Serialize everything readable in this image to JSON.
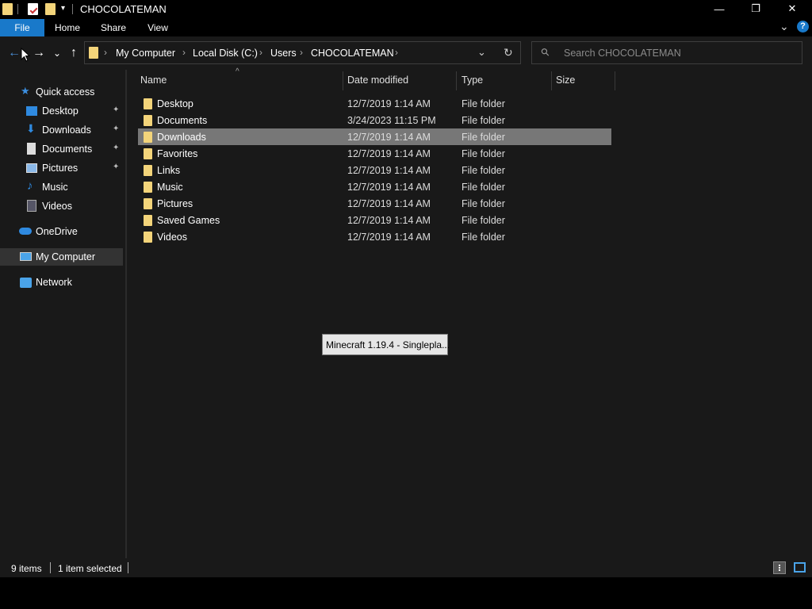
{
  "window": {
    "title": "CHOCOLATEMAN",
    "minimize": "—",
    "restore": "❐",
    "close": "✕"
  },
  "ribbon": {
    "tabs": [
      "File",
      "Home",
      "Share",
      "View"
    ],
    "expand": "⌄",
    "help": "?"
  },
  "nav": {
    "back": "←",
    "forward": "→",
    "recent": "⌄",
    "up": "↑"
  },
  "address": {
    "crumbs": [
      "My Computer",
      "Local Disk (C:)",
      "Users",
      "CHOCOLATEMAN"
    ],
    "separator": "›",
    "dropdown": "⌄",
    "refresh": "↻"
  },
  "search": {
    "placeholder": "Search CHOCOLATEMAN",
    "icon": "⚲"
  },
  "sidebar": {
    "quick_access": "Quick access",
    "pinned": [
      {
        "label": "Desktop",
        "icon": "desktop-icon"
      },
      {
        "label": "Downloads",
        "icon": "downloads-icon"
      },
      {
        "label": "Documents",
        "icon": "documents-icon"
      },
      {
        "label": "Pictures",
        "icon": "pictures-icon"
      }
    ],
    "unpinned": [
      {
        "label": "Music",
        "icon": "music-icon"
      },
      {
        "label": "Videos",
        "icon": "videos-icon"
      }
    ],
    "onedrive": "OneDrive",
    "my_computer": "My Computer",
    "network": "Network",
    "pin_glyph": "📌"
  },
  "columns": {
    "name": "Name",
    "date": "Date modified",
    "type": "Type",
    "size": "Size",
    "sort_glyph": "^"
  },
  "files": [
    {
      "name": "Desktop",
      "date": "12/7/2019 1:14 AM",
      "type": "File folder"
    },
    {
      "name": "Documents",
      "date": "3/24/2023 11:15 PM",
      "type": "File folder"
    },
    {
      "name": "Downloads",
      "date": "12/7/2019 1:14 AM",
      "type": "File folder",
      "selected": true
    },
    {
      "name": "Favorites",
      "date": "12/7/2019 1:14 AM",
      "type": "File folder"
    },
    {
      "name": "Links",
      "date": "12/7/2019 1:14 AM",
      "type": "File folder"
    },
    {
      "name": "Music",
      "date": "12/7/2019 1:14 AM",
      "type": "File folder"
    },
    {
      "name": "Pictures",
      "date": "12/7/2019 1:14 AM",
      "type": "File folder"
    },
    {
      "name": "Saved Games",
      "date": "12/7/2019 1:14 AM",
      "type": "File folder"
    },
    {
      "name": "Videos",
      "date": "12/7/2019 1:14 AM",
      "type": "File folder"
    }
  ],
  "drag_tooltip": "Minecraft 1.19.4 - Singlepla...",
  "status": {
    "items": "9 items",
    "selected": "1 item selected"
  },
  "colors": {
    "accent": "#1979ca",
    "folder": "#f3d47a",
    "background": "#191919",
    "selection": "#777777"
  }
}
